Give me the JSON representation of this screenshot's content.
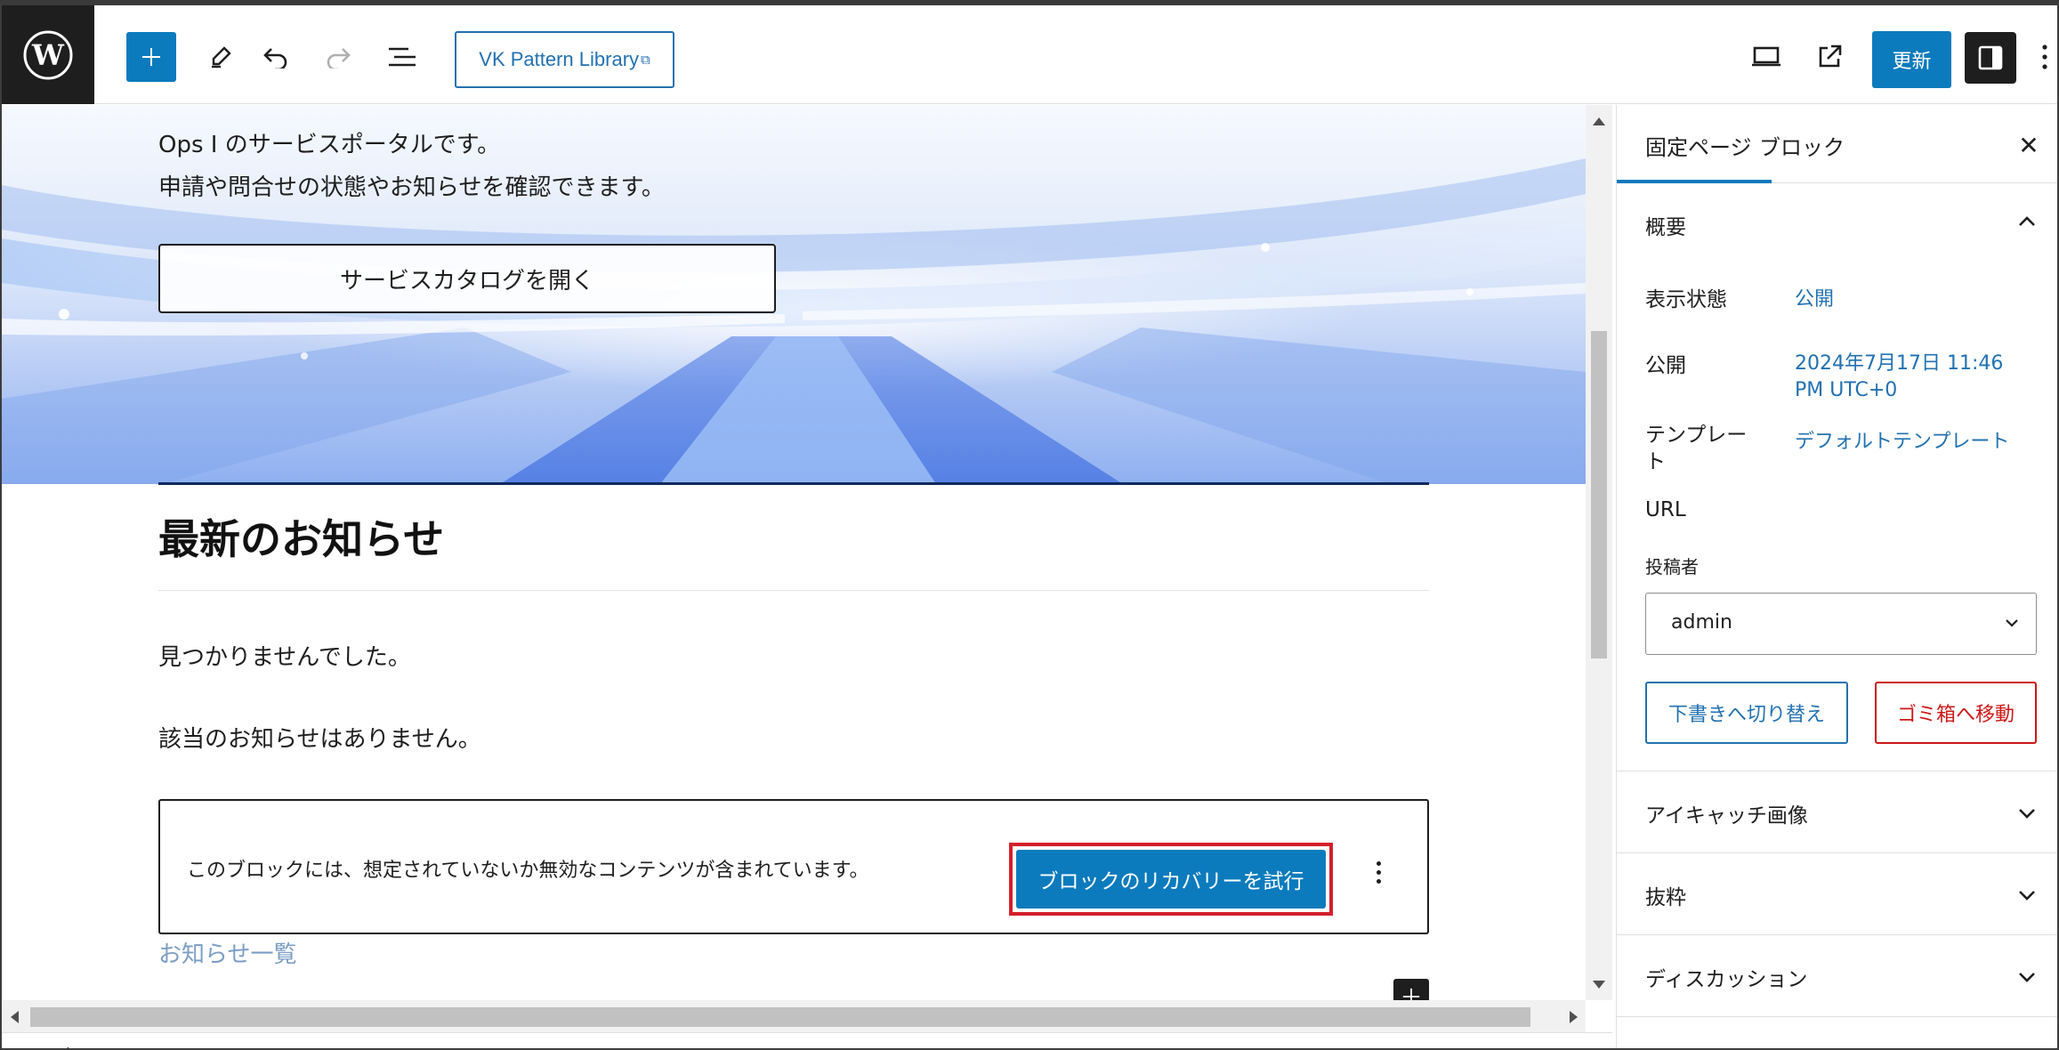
{
  "toolbar": {
    "pattern_library_label": "VK Pattern Library",
    "update_label": "更新"
  },
  "hero": {
    "line1": "Ops I のサービスポータルです。",
    "line2": "申請や問合せの状態やお知らせを確認できます。",
    "catalog_button": "サービスカタログを開く"
  },
  "news": {
    "title": "最新のお知らせ",
    "not_found": "見つかりませんでした。",
    "no_news": "該当のお知らせはありません。",
    "invalid_block_message": "このブロックには、想定されていないか無効なコンテンツが含まれています。",
    "recovery_button": "ブロックのリカバリーを試行",
    "list_link": "お知らせ一覧"
  },
  "breadcrumb": {
    "label": "固定ページ"
  },
  "sidebar": {
    "tabs": [
      {
        "label": "固定ページ",
        "active": true
      },
      {
        "label": "ブロック",
        "active": false
      }
    ],
    "summary_title": "概要",
    "rows": {
      "visibility_label": "表示状態",
      "visibility_value": "公開",
      "publish_label": "公開",
      "publish_value": "2024年7月17日 11:46 PM UTC+0",
      "template_label": "テンプレート",
      "template_value": "デフォルトテンプレート",
      "url_label": "URL",
      "author_label": "投稿者",
      "author_value": "admin"
    },
    "draft_button": "下書きへ切り替え",
    "trash_button": "ゴミ箱へ移動",
    "panels": [
      {
        "title": "アイキャッチ画像"
      },
      {
        "title": "抜粋"
      },
      {
        "title": "ディスカッション"
      }
    ]
  },
  "icons": {
    "logo": "wordpress-logo-icon",
    "add": "plus-icon",
    "edit": "pencil-icon",
    "undo": "undo-icon",
    "redo": "redo-icon",
    "list": "list-view-icon",
    "external": "external-link-icon",
    "preview": "desktop-preview-icon",
    "view": "view-post-icon",
    "settings": "sidebar-settings-icon",
    "more": "more-vertical-icon",
    "close": "close-icon",
    "chevron_up": "chevron-up-icon",
    "chevron_down": "chevron-down-icon"
  },
  "colors": {
    "primary": "#0c7bbd",
    "link": "#2271b1",
    "danger": "#cc1818",
    "highlight": "#d4202a",
    "dark": "#1e1e1e"
  }
}
